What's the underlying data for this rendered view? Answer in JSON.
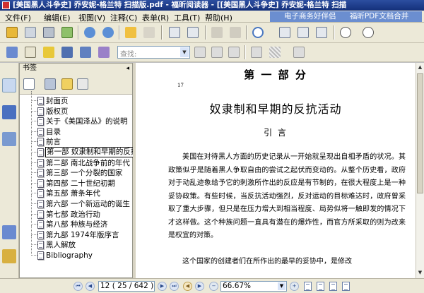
{
  "window": {
    "title": "[美国黑人斗争史] 乔安妮-格兰特 扫描版.pdf - 福昕阅读器 - [[美国黑人斗争史] 乔安妮-格兰特 扫描"
  },
  "menubar": {
    "items": [
      "文件(F)",
      "编辑(E)",
      "视图(V)",
      "注释(C)",
      "表单(R)",
      "工具(T)",
      "帮助(H)"
    ],
    "promo": [
      "电子商务好伴侣",
      "福昕PDF文档合并"
    ]
  },
  "toolbar2": {
    "search_placeholder": "查找:"
  },
  "bookmarks": {
    "title": "书签",
    "close": "◂",
    "items": [
      "封面页",
      "版权页",
      "关于《美国泽丛》的说明",
      "目录",
      "前言",
      "第一部 奴隶制和早期的反抗活动",
      "第二部 南北战争前的年代",
      "第三部 一个分裂的国家",
      "第四部 二十世纪初期",
      "第五部 萧条年代",
      "第六部 一个新运动的诞生",
      "第七部 政治行动",
      "第八部 种族与经济",
      "第九部 1974年版序言",
      "黑人解放",
      "Bibliography"
    ],
    "selected_index": 5
  },
  "document": {
    "part_title": "第 一 部 分",
    "page_marker": "17",
    "chapter_title": "奴隶制和早期的反抗活动",
    "section_title": "引 言",
    "paragraphs": [
      "美国在对待黑人方面的历史记录从一开始就呈现出自相矛盾的状况。其政策似乎是随着黑人争取自由的尝试之起伏而变动的。从整个历史看，政府对于动乱迹象给予它的刺激所作出的反应是有节制的，在很大程度上是一种妥协政策。有些时候，当反抗活动强烈，反对运动的目标难达时，政府曾采取了重大步骤，但只是在压力增大到相当程度、局势似将一触即发的情况下才这样做。这个种族问题一直具有潜在的爆炸性，而官方所采取的则为改来是权宜的对策。",
      "这个国家的创建者们在所作出的最早的妥协中，是修改"
    ]
  },
  "statusbar": {
    "page_display": "12  ( 25 / 642 )",
    "zoom": "66.67%"
  }
}
